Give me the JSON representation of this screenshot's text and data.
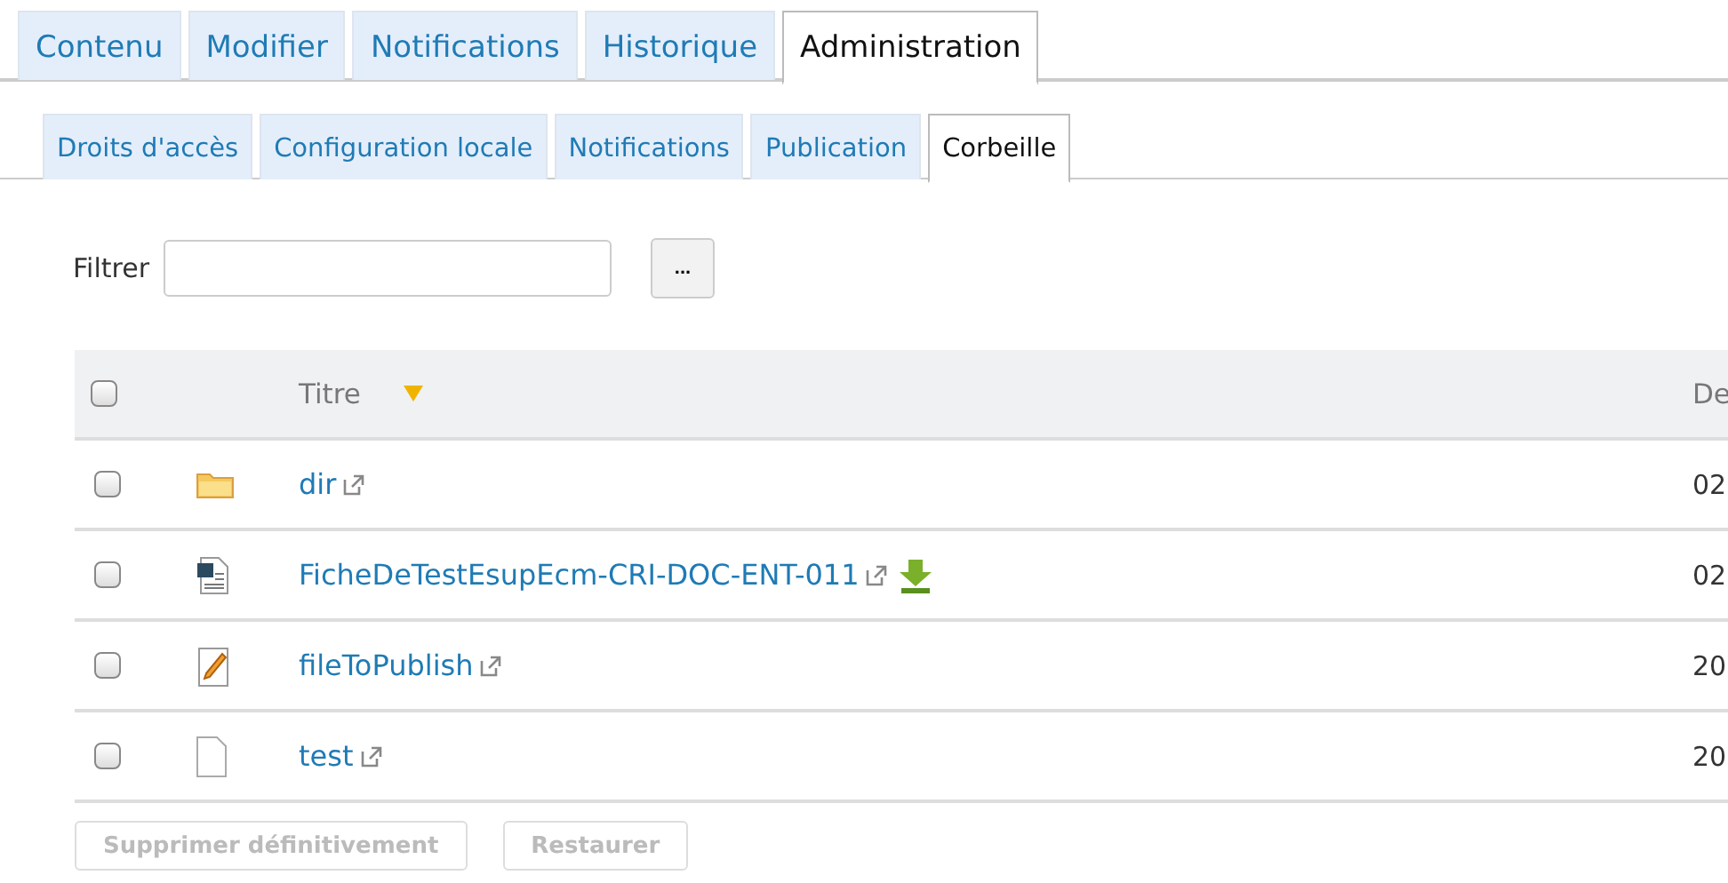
{
  "tabs": [
    {
      "label": "Contenu",
      "selected": false
    },
    {
      "label": "Modifier",
      "selected": false
    },
    {
      "label": "Notifications",
      "selected": false
    },
    {
      "label": "Historique",
      "selected": false
    },
    {
      "label": "Administration",
      "selected": true
    }
  ],
  "subtabs": [
    {
      "label": "Droits d'accès",
      "selected": false
    },
    {
      "label": "Configuration locale",
      "selected": false
    },
    {
      "label": "Notifications",
      "selected": false
    },
    {
      "label": "Publication",
      "selected": false
    },
    {
      "label": "Corbeille",
      "selected": true
    }
  ],
  "filter": {
    "label": "Filtrer",
    "button": "..."
  },
  "table": {
    "select_all_checked": false,
    "columns": [
      "Titre",
      "De"
    ],
    "rows": [
      {
        "kind": "folder",
        "title": "dir",
        "checked": false,
        "download": false,
        "column_2": "02"
      },
      {
        "kind": "document",
        "title": "FicheDeTestEsupEcm-CRI-DOC-ENT-011",
        "checked": false,
        "download": true,
        "column_2": "02"
      },
      {
        "kind": "note",
        "title": "fileToPublish",
        "checked": false,
        "download": false,
        "column_2": "20"
      },
      {
        "kind": "file",
        "title": "test",
        "checked": false,
        "download": false,
        "column_2": "20"
      }
    ]
  },
  "buttons": [
    {
      "label": "Supprimer définitivement",
      "disabled": true
    },
    {
      "label": "Restaurer",
      "disabled": true
    }
  ]
}
